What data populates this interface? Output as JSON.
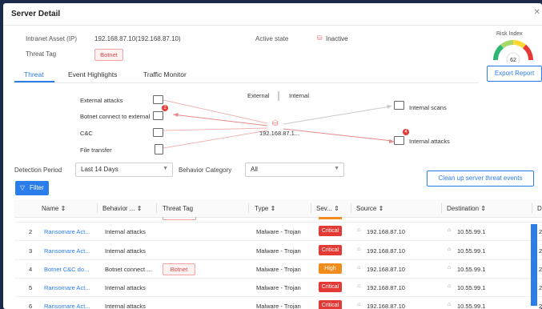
{
  "title": "Server Detail",
  "info": {
    "asset_label": "Intranet Asset (IP)",
    "asset_value": "192.168.87.10(192.168.87.10)",
    "active_label": "Active state",
    "active_value": "Inactive",
    "threat_tag_label": "Threat Tag",
    "threat_tag_value": "Botnet"
  },
  "risk": {
    "label": "Risk Index",
    "value": "62",
    "fill_fraction": 0.62
  },
  "export_label": "Export Report",
  "tabs": [
    "Threat",
    "Event Highlights",
    "Traffic Monitor"
  ],
  "active_tab": 0,
  "diagram": {
    "external_label": "External",
    "internal_label": "Internal",
    "center_ip": "192.168.87.1...",
    "left": [
      "External attacks",
      "Botnet connect to external",
      "C&C",
      "File transfer"
    ],
    "left_badge": "2",
    "right": [
      "Internal scans",
      "Internal attacks"
    ],
    "right_badge": "4"
  },
  "filters": {
    "period_label": "Detection Period",
    "period_value": "Last 14 Days",
    "category_label": "Behavior Category",
    "category_value": "All"
  },
  "clean_label": "Clean up server threat events",
  "filter_label": "Filter",
  "table": {
    "headers": [
      "Name",
      "Behavior ...",
      "Threat Tag",
      "Type",
      "Sev...",
      "Source",
      "Destination",
      "D"
    ],
    "rows": [
      {
        "no": "2",
        "name": "Ransomare Act...",
        "behavior": "Internal attacks",
        "tag": "",
        "type": "Malware - Trojan",
        "severity": "Critical",
        "source": "192.168.87.10",
        "dest": "10.55.99.1",
        "extra": "2"
      },
      {
        "no": "3",
        "name": "Ransomare Act...",
        "behavior": "Internal attacks",
        "tag": "",
        "type": "Malware - Trojan",
        "severity": "Critical",
        "source": "192.168.87.10",
        "dest": "10.55.99.1",
        "extra": "2"
      },
      {
        "no": "4",
        "name": "Botnet C&C do...",
        "behavior": "Botnet connect ...",
        "tag": "Botnet",
        "type": "Malware - Trojan",
        "severity": "High",
        "source": "192.168.87.10",
        "dest": "10.55.99.1",
        "extra": "2"
      },
      {
        "no": "5",
        "name": "Ransomare Act...",
        "behavior": "Internal attacks",
        "tag": "",
        "type": "Malware - Trojan",
        "severity": "Critical",
        "source": "192.168.87.10",
        "dest": "10.55.99.1",
        "extra": "2"
      },
      {
        "no": "6",
        "name": "Ransomare Act...",
        "behavior": "Internal attacks",
        "tag": "",
        "type": "Malware - Trojan",
        "severity": "Critical",
        "source": "192.168.87.10",
        "dest": "10.55.99.1",
        "extra": "2"
      }
    ]
  },
  "colors": {
    "accent": "#2b7de9",
    "critical": "#e53935",
    "high": "#f08c1c",
    "tag_red": "#e04848"
  }
}
